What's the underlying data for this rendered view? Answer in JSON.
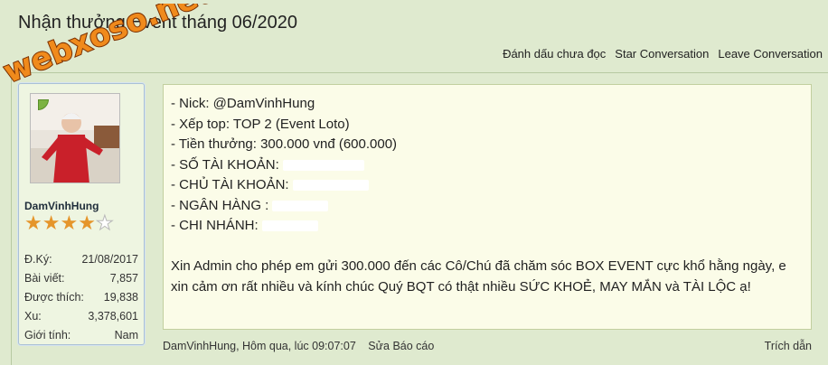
{
  "page_title": "Nhận thưởng Event tháng 06/2020",
  "watermark_text": "webxoso.net",
  "thread_actions": {
    "mark_unread": "Đánh dấu chưa đọc",
    "star": "Star Conversation",
    "leave": "Leave Conversation"
  },
  "user": {
    "name": "DamVinhHung",
    "rating_stars": 4,
    "rating_max": 5,
    "stats": [
      {
        "label": "Đ.Ký:",
        "value": "21/08/2017"
      },
      {
        "label": "Bài viết:",
        "value": "7,857"
      },
      {
        "label": "Được thích:",
        "value": "19,838"
      },
      {
        "label": "Xu:",
        "value": "3,378,601"
      },
      {
        "label": "Giới tính:",
        "value": "Nam"
      }
    ]
  },
  "post": {
    "lines": [
      "- Nick: @DamVinhHung",
      "- Xếp top: TOP 2 (Event Loto)",
      "- Tiền thưởng: 300.000 vnđ (600.000)",
      "- SỐ TÀI KHOẢN:",
      "- CHỦ TÀI KHOẢN:",
      "- NGÂN HÀNG :",
      "- CHI NHÁNH:"
    ],
    "message": "Xin Admin cho phép em gửi 300.000 đến các Cô/Chú đã chăm sóc BOX EVENT cực khổ hằng ngày, e xin cảm ơn rất nhiều và kính chúc Quý BQT có thật nhiều SỨC KHOẺ, MAY MẮN và TÀI LỘC ạ!"
  },
  "footer": {
    "author_time": "DamVinhHung, Hôm qua, lúc 09:07:07",
    "edit": "Sửa",
    "report": "Báo cáo",
    "quote": "Trích dẫn"
  }
}
